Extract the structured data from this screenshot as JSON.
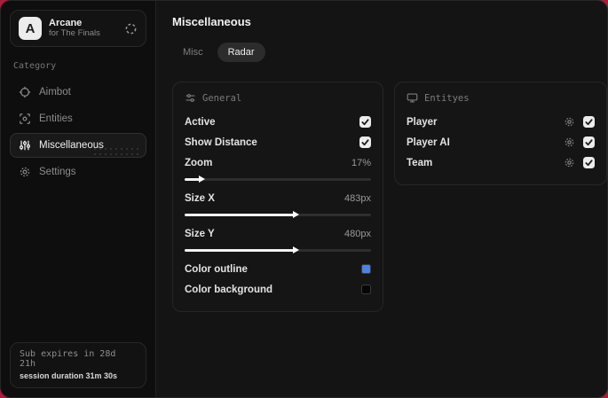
{
  "colors": {
    "page_background": "#a81e3a",
    "window_background": "#121212",
    "accent_outline_swatch": "#4e82e0",
    "background_swatch": "#060606"
  },
  "sidebar": {
    "app": {
      "logo_letter": "A",
      "name": "Arcane",
      "subtitle": "for The Finals"
    },
    "category_label": "Category",
    "items": [
      {
        "label": "Aimbot",
        "active": false
      },
      {
        "label": "Entities",
        "active": false
      },
      {
        "label": "Miscellaneous",
        "active": true
      },
      {
        "label": "Settings",
        "active": false
      }
    ],
    "footer": {
      "line1": "Sub expires in 28d 21h",
      "line2": "session duration 31m 30s"
    }
  },
  "main": {
    "title": "Miscellaneous",
    "tabs": [
      {
        "label": "Misc",
        "active": false
      },
      {
        "label": "Radar",
        "active": true
      }
    ],
    "general": {
      "title": "General",
      "active": {
        "label": "Active",
        "checked": true
      },
      "show_distance": {
        "label": "Show Distance",
        "checked": true
      },
      "zoom": {
        "label": "Zoom",
        "value": "17%",
        "slider_percent": 8.5
      },
      "size_x": {
        "label": "Size X",
        "value": "483px",
        "slider_percent": 59
      },
      "size_y": {
        "label": "Size Y",
        "value": "480px",
        "slider_percent": 59
      },
      "color_outline": {
        "label": "Color outline",
        "color": "#4e82e0"
      },
      "color_background": {
        "label": "Color background",
        "color": "#060606"
      }
    },
    "entities": {
      "title": "Entityes",
      "rows": [
        {
          "label": "Player",
          "checked": true
        },
        {
          "label": "Player AI",
          "checked": true
        },
        {
          "label": "Team",
          "checked": true
        }
      ]
    }
  }
}
